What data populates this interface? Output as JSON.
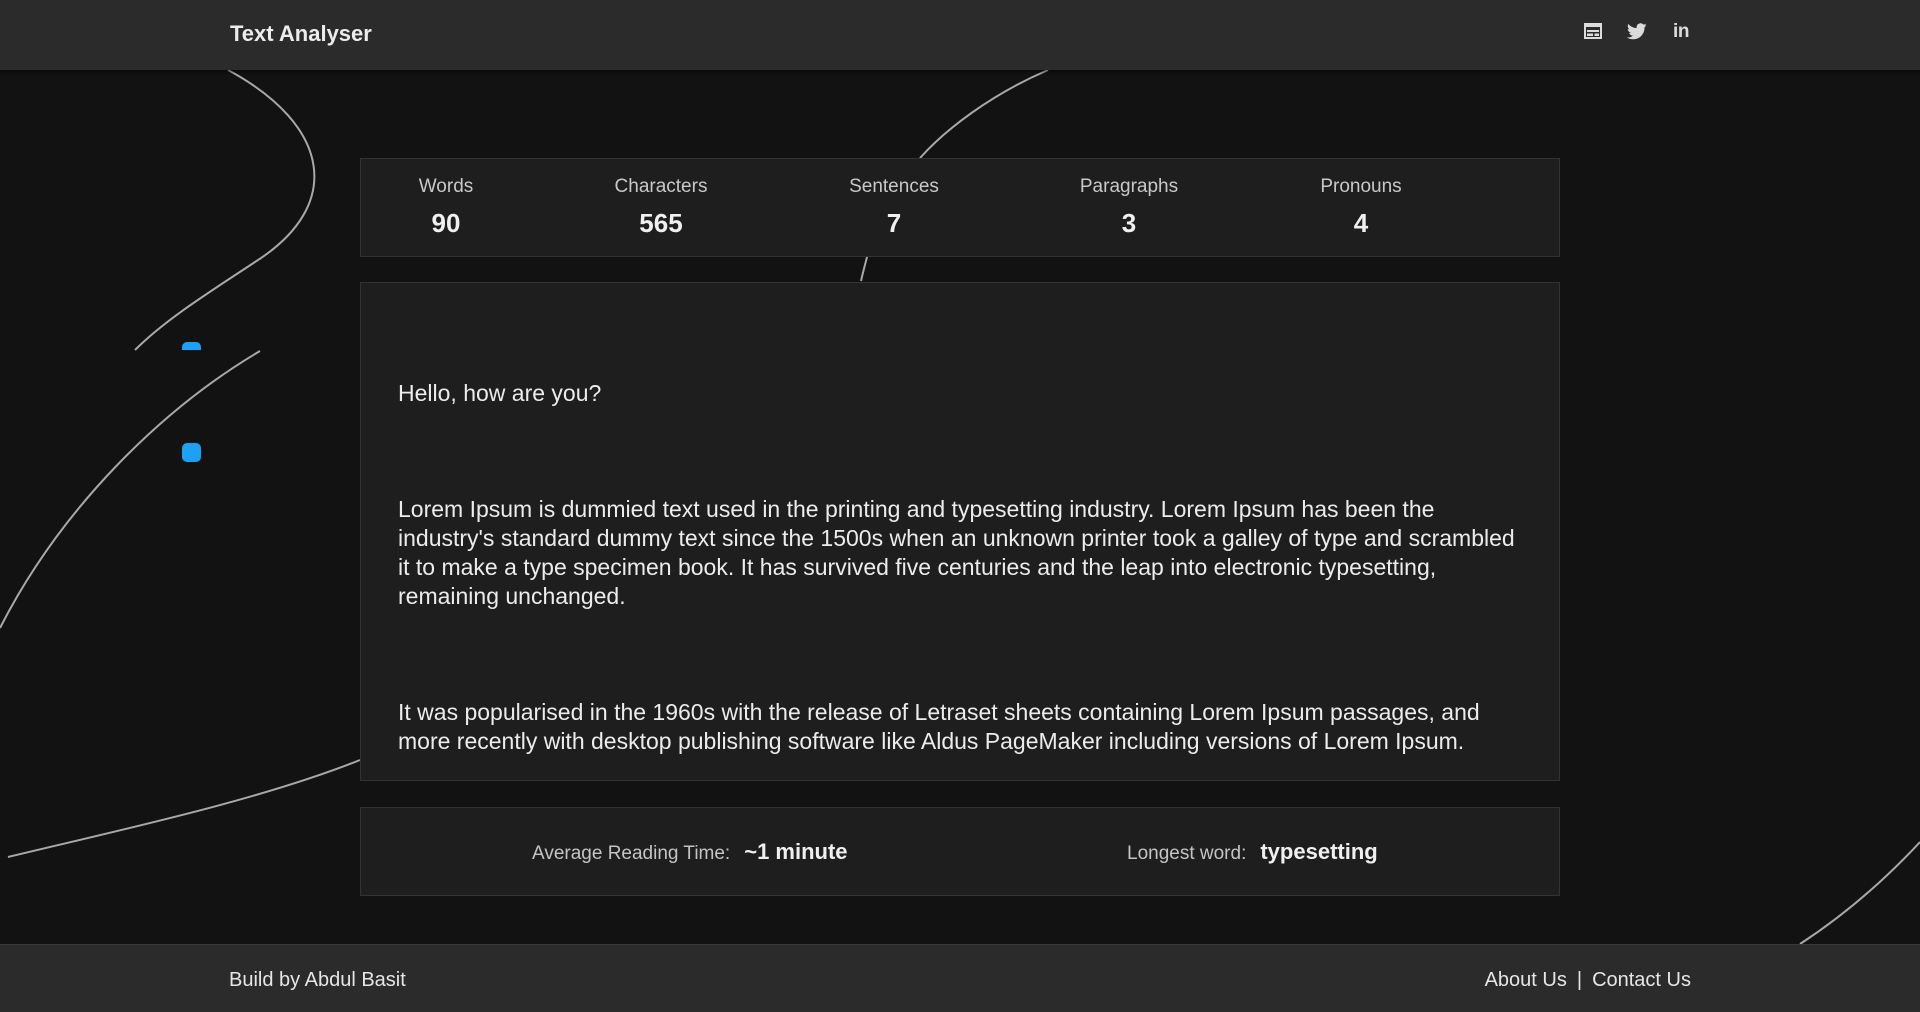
{
  "header": {
    "title": "Text Analyser",
    "icons": [
      {
        "name": "portfolio-icon",
        "glyph": "browser-window"
      },
      {
        "name": "twitter-icon",
        "glyph": "bird"
      },
      {
        "name": "linkedin-icon",
        "glyph": "in"
      }
    ],
    "linkedin_glyph": "in"
  },
  "stats": [
    {
      "label": "Words",
      "value": "90"
    },
    {
      "label": "Characters",
      "value": "565"
    },
    {
      "label": "Sentences",
      "value": "7"
    },
    {
      "label": "Paragraphs",
      "value": "3"
    },
    {
      "label": "Pronouns",
      "value": "4"
    }
  ],
  "editor": {
    "paragraphs": [
      "Hello, how are you?",
      "Lorem Ipsum is dummied text used in the printing and typesetting industry. Lorem Ipsum has been the industry's standard dummy text since the 1500s when an unknown printer took a galley of type and scrambled it to make a type specimen book. It has survived five centuries and the leap into electronic typesetting, remaining unchanged.",
      "It was popularised in the 1960s with the release of Letraset sheets containing Lorem Ipsum passages, and more recently with desktop publishing software like Aldus PageMaker including versions of Lorem Ipsum."
    ]
  },
  "info": {
    "reading_time_label": "Average Reading Time:",
    "reading_time_value": "~1 minute",
    "longest_word_label": "Longest word:",
    "longest_word_value": "typesetting"
  },
  "footer": {
    "credit": "Build by Abdul Basit",
    "about_label": "About Us",
    "separator": "|",
    "contact_label": "Contact Us"
  },
  "colors": {
    "accent": "#1da1f2",
    "header_bg": "#2b2b2b",
    "page_bg": "#121212",
    "panel_bg": "#1e1e1e"
  }
}
